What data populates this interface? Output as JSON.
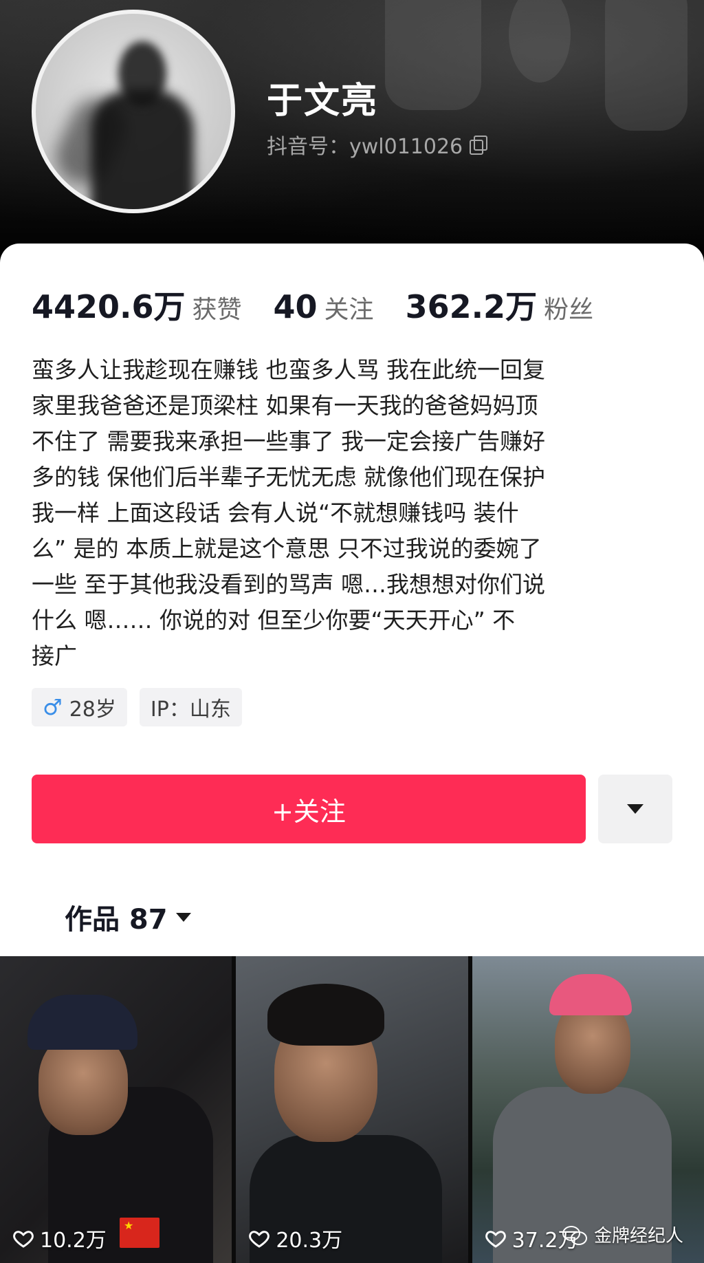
{
  "profile": {
    "name": "于文亮",
    "douyin_id": "抖音号：ywl011026"
  },
  "stats": [
    {
      "value": "4420.6万",
      "label": "获赞"
    },
    {
      "value": "40",
      "label": "关注"
    },
    {
      "value": "362.2万",
      "label": "粉丝"
    }
  ],
  "bio": "蛮多人让我趁现在赚钱 也蛮多人骂 我在此统一回复\n家里我爸爸还是顶梁柱  如果有一天我的爸爸妈妈顶\n不住了 需要我来承担一些事了  我一定会接广告赚好\n多的钱 保他们后半辈子无忧无虑  就像他们现在保护\n我一样 上面这段话 会有人说“不就想赚钱吗 装什\n么” 是的 本质上就是这个意思 只不过我说的委婉了\n一些 至于其他我没看到的骂声  嗯…我想想对你们说\n什么   嗯…… 你说的对 但至少你要“天天开心”  不\n接广",
  "tags": {
    "age": "28岁",
    "ip": "IP：山东"
  },
  "actions": {
    "follow_label": "+关注"
  },
  "works": {
    "label": "作品 87"
  },
  "videos": [
    {
      "likes": "10.2万"
    },
    {
      "likes": "20.3万"
    },
    {
      "likes": "37.2万"
    }
  ],
  "watermark": "金牌经纪人",
  "colors": {
    "follow_button": "#fe2c55",
    "male_icon": "#3a8ee8"
  },
  "icons": {
    "copy": "copy-icon",
    "gender": "male-icon",
    "more": "chevron-down-icon",
    "like": "heart-icon",
    "watermark": "wechat-icon"
  }
}
